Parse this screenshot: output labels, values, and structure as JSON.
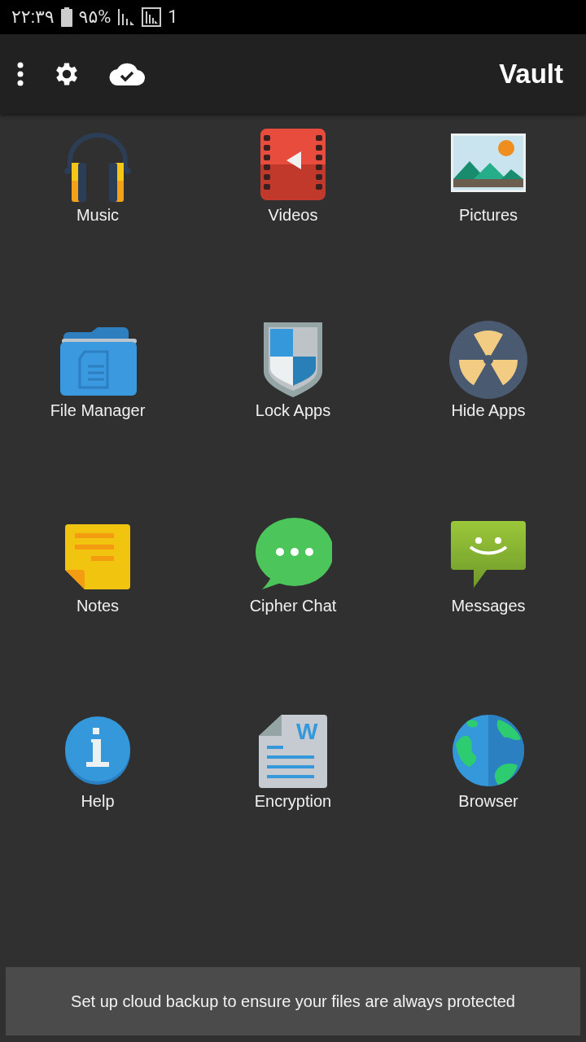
{
  "status_bar": {
    "time": "۲۲:۳۹",
    "battery": "۹۵%",
    "sim": "1"
  },
  "toolbar": {
    "title": "Vault"
  },
  "apps": [
    {
      "label": "Music",
      "kind": "music"
    },
    {
      "label": "Videos",
      "kind": "videos"
    },
    {
      "label": "Pictures",
      "kind": "pictures"
    },
    {
      "label": "File Manager",
      "kind": "files"
    },
    {
      "label": "Lock Apps",
      "kind": "shield"
    },
    {
      "label": "Hide Apps",
      "kind": "hide"
    },
    {
      "label": "Notes",
      "kind": "notes"
    },
    {
      "label": "Cipher Chat",
      "kind": "chat"
    },
    {
      "label": "Messages",
      "kind": "messages"
    },
    {
      "label": "Help",
      "kind": "help"
    },
    {
      "label": "Encryption",
      "kind": "document"
    },
    {
      "label": "Browser",
      "kind": "globe"
    }
  ],
  "document_icon": {
    "letter": "W"
  },
  "toast": {
    "text": "Set up cloud backup to ensure your files are always protected"
  }
}
